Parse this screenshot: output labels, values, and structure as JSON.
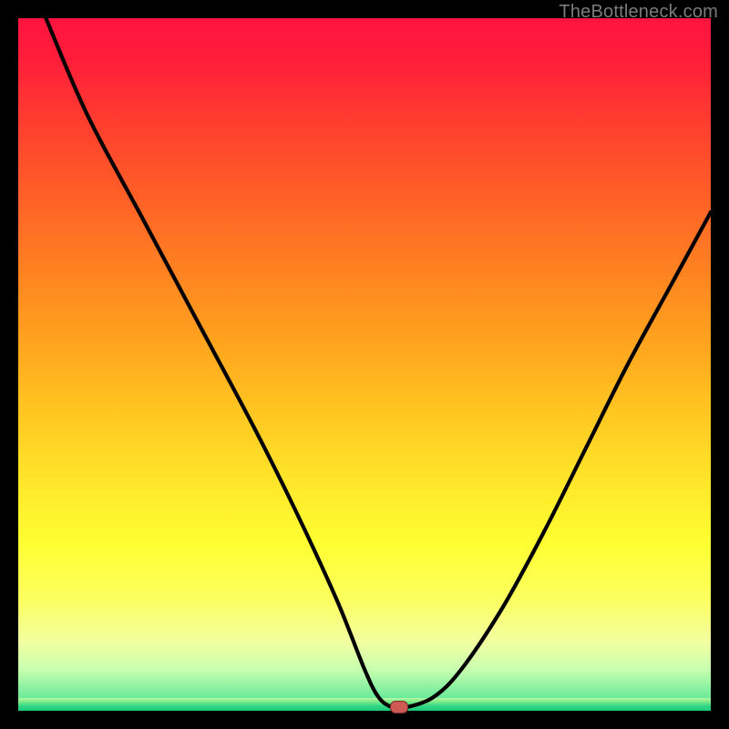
{
  "watermark": {
    "text": "TheBottleneck.com"
  },
  "chart_data": {
    "type": "line",
    "title": "",
    "xlabel": "",
    "ylabel": "",
    "xlim": [
      0,
      100
    ],
    "ylim": [
      0,
      100
    ],
    "series": [
      {
        "name": "bottleneck-curve",
        "x": [
          4,
          10,
          18,
          26,
          34,
          40,
          46,
          50,
          52,
          54,
          56,
          60,
          64,
          70,
          76,
          82,
          88,
          94,
          100
        ],
        "values": [
          100,
          86,
          71,
          56,
          41,
          29,
          16,
          6,
          2,
          0.5,
          0.5,
          2,
          6,
          15,
          26,
          38,
          50,
          61,
          72
        ]
      }
    ],
    "marker": {
      "x": 55,
      "y": 0.5
    },
    "gradient_bands": [
      "#ff1440",
      "#ff5a28",
      "#ffc020",
      "#ffff32",
      "#7be98a",
      "#1cc87a"
    ]
  }
}
